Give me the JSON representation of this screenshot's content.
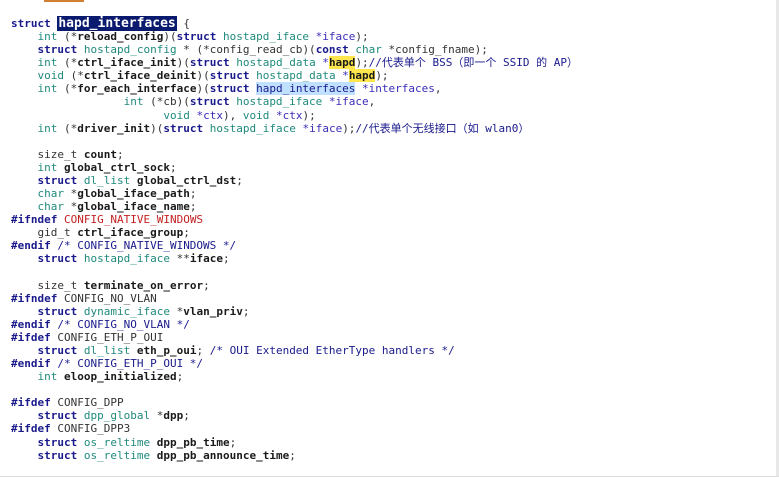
{
  "code_lines": [
    [
      [
        "kw",
        "struct "
      ],
      [
        "hl-sel",
        "hapd_interfaces"
      ],
      [
        "plain",
        " {"
      ]
    ],
    [
      [
        "plain",
        "    "
      ],
      [
        "type",
        "int"
      ],
      [
        "plain",
        " (*"
      ],
      [
        "id",
        "reload_config"
      ],
      [
        "plain",
        ")("
      ],
      [
        "kw",
        "struct"
      ],
      [
        "type",
        " hostapd_iface"
      ],
      [
        "var",
        " *iface"
      ],
      [
        "plain",
        ");"
      ]
    ],
    [
      [
        "plain",
        "    "
      ],
      [
        "kw",
        "struct"
      ],
      [
        "type",
        " hostapd_config"
      ],
      [
        "plain",
        " * (*"
      ],
      [
        "plain",
        "config_read_cb"
      ],
      [
        "plain",
        ")("
      ],
      [
        "kw",
        "const"
      ],
      [
        "type",
        " char"
      ],
      [
        "plain",
        " *config_fname);"
      ]
    ],
    [
      [
        "plain",
        "    "
      ],
      [
        "type",
        "int"
      ],
      [
        "plain",
        " (*"
      ],
      [
        "id",
        "ctrl_iface_init"
      ],
      [
        "plain",
        ")("
      ],
      [
        "kw",
        "struct"
      ],
      [
        "type",
        " hostapd_data"
      ],
      [
        "var",
        " *"
      ],
      [
        "hl-yel",
        "hapd"
      ],
      [
        "plain",
        ");"
      ],
      [
        "comment",
        "//代表单个 BSS（即一个 SSID 的 AP）"
      ]
    ],
    [
      [
        "plain",
        "    "
      ],
      [
        "type",
        "void"
      ],
      [
        "plain",
        " (*"
      ],
      [
        "id",
        "ctrl_iface_deinit"
      ],
      [
        "plain",
        ")("
      ],
      [
        "kw",
        "struct"
      ],
      [
        "type",
        " hostapd_data"
      ],
      [
        "var",
        " *"
      ],
      [
        "hl-yel",
        "hapd"
      ],
      [
        "plain",
        ");"
      ]
    ],
    [
      [
        "plain",
        "    "
      ],
      [
        "type",
        "int"
      ],
      [
        "plain",
        " (*"
      ],
      [
        "id",
        "for_each_interface"
      ],
      [
        "plain",
        ")("
      ],
      [
        "kw",
        "struct "
      ],
      [
        "hl-blue",
        "hapd_interfaces"
      ],
      [
        "var",
        " *interfaces"
      ],
      [
        "plain",
        ","
      ]
    ],
    [
      [
        "plain",
        "                 "
      ],
      [
        "type",
        "int"
      ],
      [
        "plain",
        " (*cb)("
      ],
      [
        "kw",
        "struct"
      ],
      [
        "type",
        " hostapd_iface"
      ],
      [
        "var",
        " *iface"
      ],
      [
        "plain",
        ","
      ]
    ],
    [
      [
        "plain",
        "                       "
      ],
      [
        "type",
        "void"
      ],
      [
        "var",
        " *ctx"
      ],
      [
        "plain",
        "), "
      ],
      [
        "type",
        "void"
      ],
      [
        "var",
        " *ctx"
      ],
      [
        "plain",
        ");"
      ]
    ],
    [
      [
        "plain",
        "    "
      ],
      [
        "type",
        "int"
      ],
      [
        "plain",
        " (*"
      ],
      [
        "id",
        "driver_init"
      ],
      [
        "plain",
        ")("
      ],
      [
        "kw",
        "struct"
      ],
      [
        "type",
        " hostapd_iface"
      ],
      [
        "var",
        " *iface"
      ],
      [
        "plain",
        ");"
      ],
      [
        "comment",
        "//代表单个无线接口（如 wlan0）"
      ]
    ],
    [],
    [
      [
        "plain",
        "    size_t "
      ],
      [
        "id",
        "count"
      ],
      [
        "plain",
        ";"
      ]
    ],
    [
      [
        "plain",
        "    "
      ],
      [
        "type",
        "int"
      ],
      [
        "plain",
        " "
      ],
      [
        "id",
        "global_ctrl_sock"
      ],
      [
        "plain",
        ";"
      ]
    ],
    [
      [
        "plain",
        "    "
      ],
      [
        "kw",
        "struct"
      ],
      [
        "type",
        " dl_list"
      ],
      [
        "plain",
        " "
      ],
      [
        "id",
        "global_ctrl_dst"
      ],
      [
        "plain",
        ";"
      ]
    ],
    [
      [
        "plain",
        "    "
      ],
      [
        "type",
        "char"
      ],
      [
        "plain",
        " *"
      ],
      [
        "id",
        "global_iface_path"
      ],
      [
        "plain",
        ";"
      ]
    ],
    [
      [
        "plain",
        "    "
      ],
      [
        "type",
        "char"
      ],
      [
        "plain",
        " *"
      ],
      [
        "id",
        "global_iface_name"
      ],
      [
        "plain",
        ";"
      ]
    ],
    [
      [
        "pre",
        "#ifndef "
      ],
      [
        "macro",
        "CONFIG_NATIVE_WINDOWS"
      ]
    ],
    [
      [
        "plain",
        "    gid_t "
      ],
      [
        "id",
        "ctrl_iface_group"
      ],
      [
        "plain",
        ";"
      ]
    ],
    [
      [
        "pre",
        "#endif "
      ],
      [
        "comment",
        "/* CONFIG_NATIVE_WINDOWS */"
      ]
    ],
    [
      [
        "plain",
        "    "
      ],
      [
        "kw",
        "struct"
      ],
      [
        "type",
        " hostapd_iface"
      ],
      [
        "plain",
        " **"
      ],
      [
        "id",
        "iface"
      ],
      [
        "plain",
        ";"
      ]
    ],
    [],
    [
      [
        "plain",
        "    size_t "
      ],
      [
        "id",
        "terminate_on_error"
      ],
      [
        "plain",
        ";"
      ]
    ],
    [
      [
        "pre",
        "#ifndef "
      ],
      [
        "plain",
        "CONFIG_NO_VLAN"
      ]
    ],
    [
      [
        "plain",
        "    "
      ],
      [
        "kw",
        "struct"
      ],
      [
        "type",
        " dynamic_iface"
      ],
      [
        "plain",
        " *"
      ],
      [
        "id",
        "vlan_priv"
      ],
      [
        "plain",
        ";"
      ]
    ],
    [
      [
        "pre",
        "#endif "
      ],
      [
        "comment",
        "/* CONFIG_NO_VLAN */"
      ]
    ],
    [
      [
        "pre",
        "#ifdef "
      ],
      [
        "plain",
        "CONFIG_ETH_P_OUI"
      ]
    ],
    [
      [
        "plain",
        "    "
      ],
      [
        "kw",
        "struct"
      ],
      [
        "type",
        " dl_list"
      ],
      [
        "plain",
        " "
      ],
      [
        "id",
        "eth_p_oui"
      ],
      [
        "plain",
        "; "
      ],
      [
        "comment",
        "/* OUI Extended EtherType handlers */"
      ]
    ],
    [
      [
        "pre",
        "#endif "
      ],
      [
        "comment",
        "/* CONFIG_ETH_P_OUI */"
      ]
    ],
    [
      [
        "plain",
        "    "
      ],
      [
        "type",
        "int"
      ],
      [
        "plain",
        " "
      ],
      [
        "id",
        "eloop_initialized"
      ],
      [
        "plain",
        ";"
      ]
    ],
    [],
    [
      [
        "pre",
        "#ifdef "
      ],
      [
        "plain",
        "CONFIG_DPP"
      ]
    ],
    [
      [
        "plain",
        "    "
      ],
      [
        "kw",
        "struct"
      ],
      [
        "type",
        " dpp_global"
      ],
      [
        "plain",
        " *"
      ],
      [
        "id",
        "dpp"
      ],
      [
        "plain",
        ";"
      ]
    ],
    [
      [
        "pre",
        "#ifdef "
      ],
      [
        "plain",
        "CONFIG_DPP3"
      ]
    ],
    [
      [
        "plain",
        "    "
      ],
      [
        "kw",
        "struct"
      ],
      [
        "type",
        " os_reltime"
      ],
      [
        "plain",
        " "
      ],
      [
        "id",
        "dpp_pb_time"
      ],
      [
        "plain",
        ";"
      ]
    ],
    [
      [
        "plain",
        "    "
      ],
      [
        "kw",
        "struct"
      ],
      [
        "type",
        " os_reltime"
      ],
      [
        "plain",
        " "
      ],
      [
        "id",
        "dpp_pb_announce_time"
      ],
      [
        "plain",
        ";"
      ]
    ]
  ]
}
